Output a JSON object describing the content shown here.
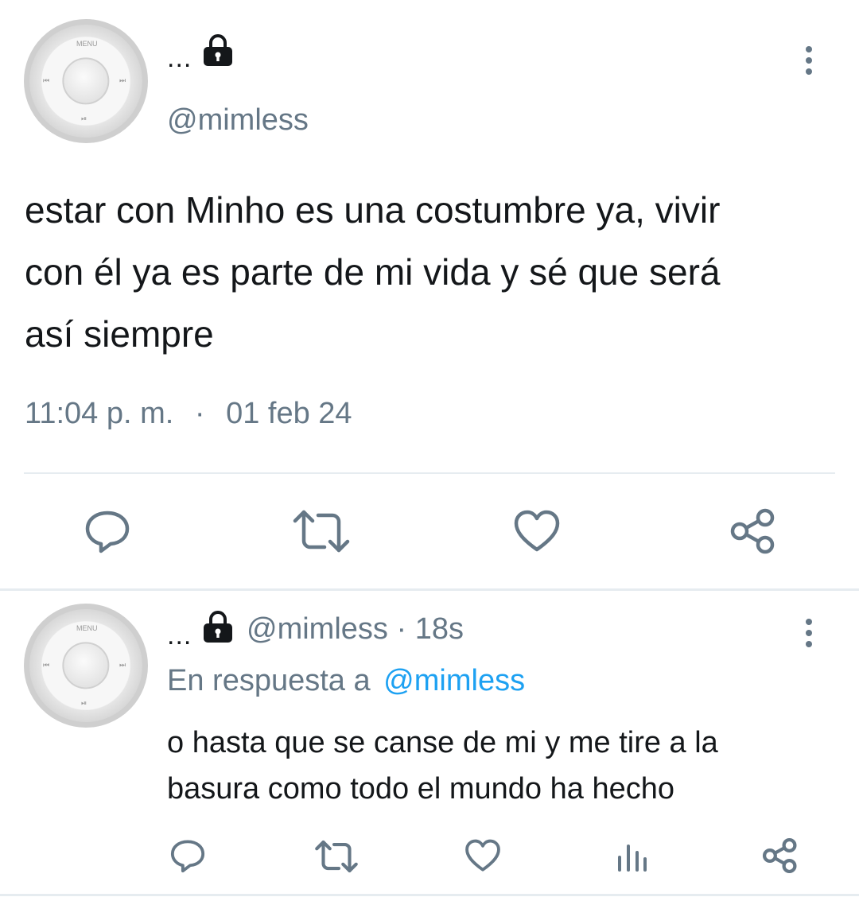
{
  "tweet": {
    "display_name": "...",
    "handle": "@mimless",
    "avatar_labels": {
      "menu": "MENU",
      "prev": "⏮",
      "next": "⏭",
      "play": "⏯"
    },
    "text_lines": [
      "estar con Minho es una costumbre ya, vivir",
      "con él ya es parte de mi vida y sé que será",
      "así siempre"
    ],
    "time": "11:04 p. m.",
    "separator": "·",
    "date": "01 feb 24"
  },
  "reply": {
    "display_name": "...",
    "handle": "@mimless",
    "dot": "·",
    "age": "18s",
    "in_reply_prefix": "En respuesta a",
    "in_reply_handle": "@mimless",
    "text_lines": [
      "o hasta que se canse de mi y me tire a la",
      "basura como todo el mundo ha hecho"
    ],
    "avatar_labels": {
      "menu": "MENU",
      "prev": "⏮",
      "next": "⏭",
      "play": "⏯"
    }
  },
  "colors": {
    "text": "#14171a",
    "muted": "#657786",
    "link": "#1da1f2",
    "divider": "#e6ecf0"
  },
  "icons": {
    "tweet_actions": [
      "reply-icon",
      "retweet-icon",
      "like-icon",
      "share-icon"
    ],
    "reply_actions": [
      "reply-icon",
      "retweet-icon",
      "like-icon",
      "analytics-icon",
      "share-icon"
    ]
  }
}
